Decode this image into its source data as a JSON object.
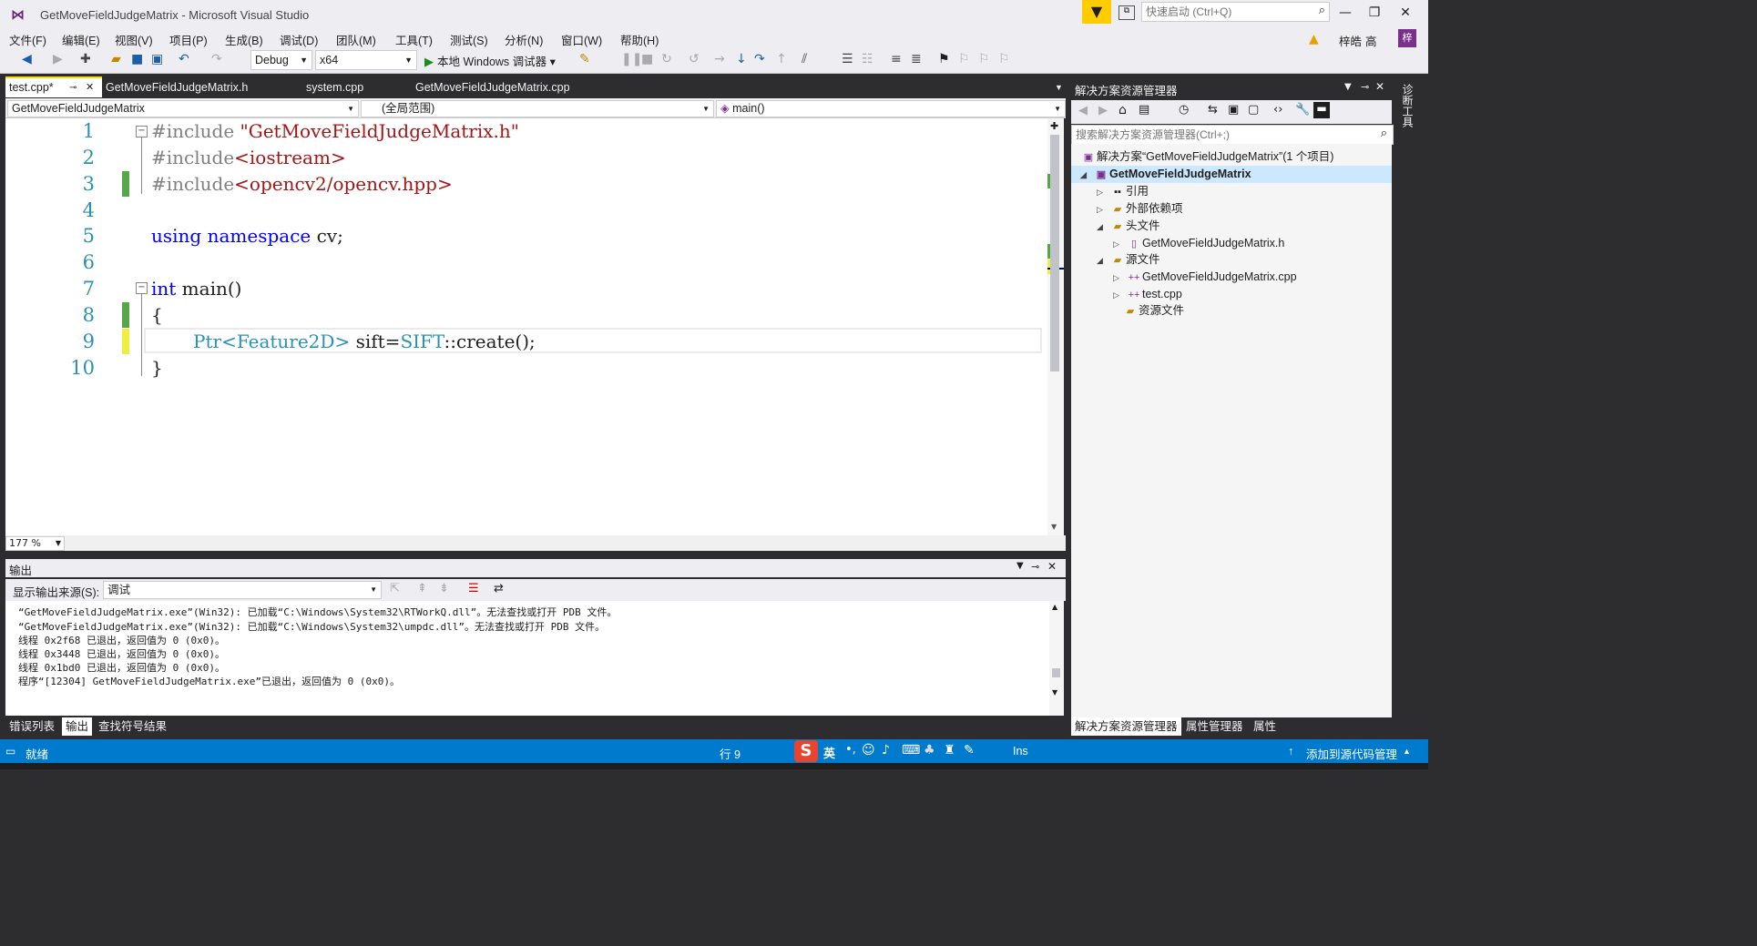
{
  "window": {
    "title": "GetMoveFieldJudgeMatrix - Microsoft Visual Studio",
    "quick_launch_placeholder": "快速启动 (Ctrl+Q)",
    "user_name": "梓皓 高",
    "user_avatar": "梓"
  },
  "menu": [
    "文件(F)",
    "编辑(E)",
    "视图(V)",
    "项目(P)",
    "生成(B)",
    "调试(D)",
    "团队(M)",
    "工具(T)",
    "测试(S)",
    "分析(N)",
    "窗口(W)",
    "帮助(H)"
  ],
  "toolbar": {
    "configuration": "Debug",
    "platform": "x64",
    "debugger_label": "本地 Windows 调试器"
  },
  "doc_tabs": [
    "test.cpp*",
    "GetMoveFieldJudgeMatrix.h",
    "system.cpp",
    "GetMoveFieldJudgeMatrix.cpp"
  ],
  "nav": {
    "project": "GetMoveFieldJudgeMatrix",
    "scope": "(全局范围)",
    "member": "main()"
  },
  "editor": {
    "line_numbers": [
      "1",
      "2",
      "3",
      "4",
      "5",
      "6",
      "7",
      "8",
      "9",
      "10"
    ],
    "lines": {
      "l1_pp": "#include ",
      "l1_str": "\"GetMoveFieldJudgeMatrix.h\"",
      "l2_pp": "#include",
      "l2_str": "<iostream>",
      "l3_pp": "#include",
      "l3_str": "<opencv2/opencv.hpp>",
      "l5_kw1": "using",
      "l5_kw2": "namespace",
      "l5_rest": " cv;",
      "l7_kw": "int",
      "l7_rest": " main()",
      "l8": "{",
      "l9_t1": "Ptr",
      "l9_p1": "<",
      "l9_t2": "Feature2D",
      "l9_p2": ">",
      "l9_mid": " sift=",
      "l9_t3": "SIFT",
      "l9_end": "::create();",
      "l10": "}"
    },
    "zoom": "177 %"
  },
  "output": {
    "title": "输出",
    "source_label": "显示输出来源(S):",
    "source_value": "调试",
    "lines": [
      "“GetMoveFieldJudgeMatrix.exe”(Win32): 已加载“C:\\Windows\\System32\\RTWorkQ.dll”。无法查找或打开 PDB 文件。",
      "“GetMoveFieldJudgeMatrix.exe”(Win32): 已加载“C:\\Windows\\System32\\umpdc.dll”。无法查找或打开 PDB 文件。",
      "线程 0x2f68 已退出，返回值为 0 (0x0)。",
      "线程 0x3448 已退出，返回值为 0 (0x0)。",
      "线程 0x1bd0 已退出，返回值为 0 (0x0)。",
      "程序“[12304] GetMoveFieldJudgeMatrix.exe”已退出，返回值为 0 (0x0)。"
    ]
  },
  "bottom_tabs": [
    "错误列表",
    "输出",
    "查找符号结果"
  ],
  "solution_explorer": {
    "title": "解决方案资源管理器",
    "search_placeholder": "搜索解决方案资源管理器(Ctrl+;)",
    "solution": "解决方案“GetMoveFieldJudgeMatrix”(1 个项目)",
    "project": "GetMoveFieldJudgeMatrix",
    "references": "引用",
    "external_deps": "外部依赖项",
    "header_files": "头文件",
    "header_file_1": "GetMoveFieldJudgeMatrix.h",
    "source_files": "源文件",
    "source_file_1": "GetMoveFieldJudgeMatrix.cpp",
    "source_file_2": "test.cpp",
    "resource_files": "资源文件",
    "bottom_tabs": [
      "解决方案资源管理器",
      "属性管理器",
      "属性"
    ]
  },
  "side_panel": "诊断工具",
  "status": {
    "ready": "就绪",
    "line": "行 9",
    "mode": "Ins",
    "source_control": "添加到源代码管理"
  },
  "ime": {
    "lang": "英"
  }
}
